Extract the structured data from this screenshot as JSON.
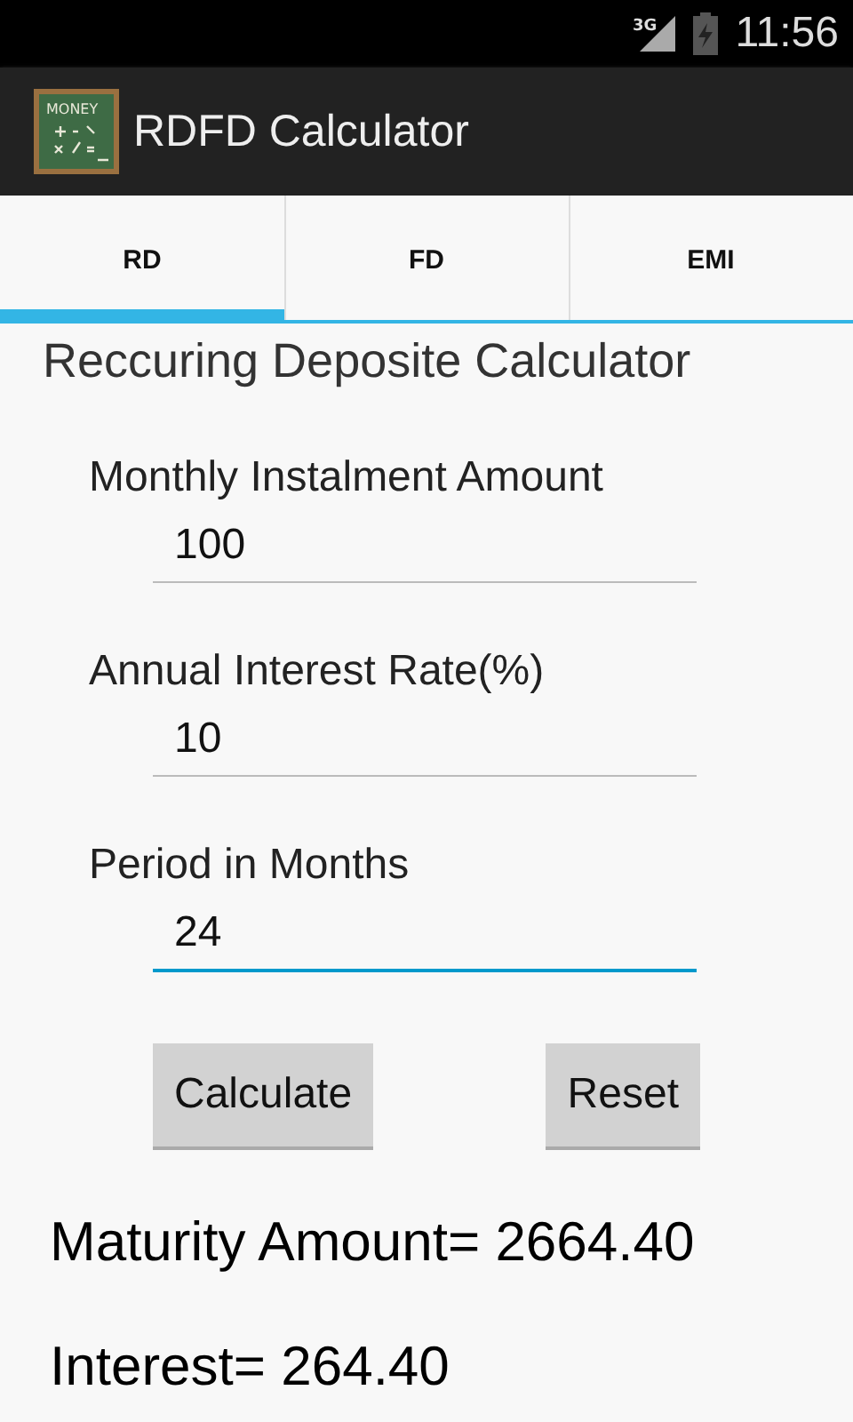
{
  "status_bar": {
    "network": "3G",
    "time": "11:56"
  },
  "action_bar": {
    "icon_text": "MONEY",
    "title": "RDFD Calculator"
  },
  "tabs": [
    {
      "label": "RD",
      "selected": true
    },
    {
      "label": "FD",
      "selected": false
    },
    {
      "label": "EMI",
      "selected": false
    }
  ],
  "heading": "Reccuring Deposite Calculator",
  "fields": [
    {
      "label": "Monthly Instalment Amount",
      "value": "100",
      "focused": false
    },
    {
      "label": "Annual Interest Rate(%)",
      "value": "10",
      "focused": false
    },
    {
      "label": "Period in Months",
      "value": "24",
      "focused": true
    }
  ],
  "buttons": [
    "Calculate",
    "Reset"
  ],
  "results": [
    "Maturity Amount= 2664.40",
    "Interest= 264.40"
  ]
}
